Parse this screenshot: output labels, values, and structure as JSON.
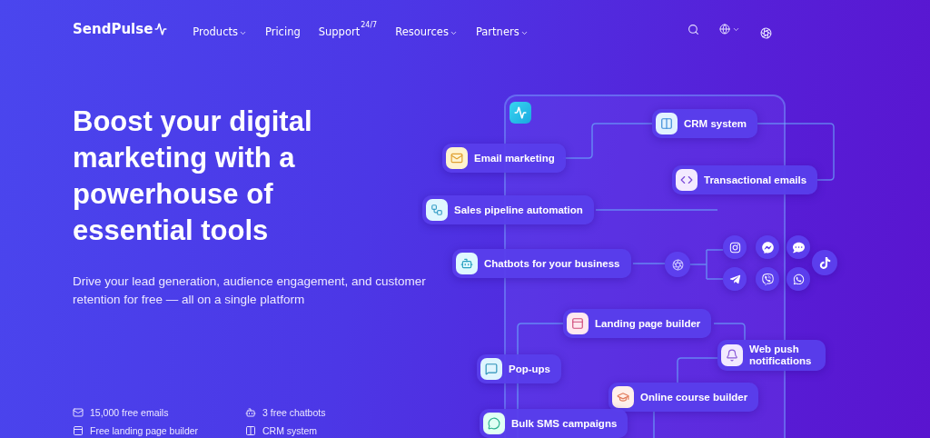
{
  "header": {
    "logo": "SendPulse",
    "nav": [
      {
        "label": "Products",
        "dropdown": true
      },
      {
        "label": "Pricing",
        "dropdown": false
      },
      {
        "label": "Support",
        "dropdown": false,
        "badge": "24/7"
      },
      {
        "label": "Resources",
        "dropdown": true
      },
      {
        "label": "Partners",
        "dropdown": true
      }
    ]
  },
  "hero": {
    "title": "Boost your digital marketing with a powerhouse of essential tools",
    "subtitle": "Drive your lead generation, audience engagement, and customer retention for free — all on a single platform",
    "features": [
      {
        "kind": "mail",
        "label": "15,000 free emails"
      },
      {
        "kind": "bot",
        "label": "3 free chatbots"
      },
      {
        "kind": "page",
        "label": "Free landing page builder"
      },
      {
        "kind": "crm",
        "label": "CRM system"
      }
    ]
  },
  "diagram": {
    "nodes": [
      {
        "kind": "crm",
        "label": "CRM system"
      },
      {
        "kind": "mail",
        "label": "Email marketing"
      },
      {
        "kind": "code",
        "label": "Transactional emails"
      },
      {
        "kind": "pipeline",
        "label": "Sales pipeline automation"
      },
      {
        "kind": "bot",
        "label": "Chatbots for your business"
      },
      {
        "kind": "page",
        "label": "Landing page builder"
      },
      {
        "kind": "push",
        "label": "Web push notifications"
      },
      {
        "kind": "popup",
        "label": "Pop-ups"
      },
      {
        "kind": "course",
        "label": "Online course builder"
      },
      {
        "kind": "sms",
        "label": "Bulk SMS campaigns"
      }
    ]
  }
}
